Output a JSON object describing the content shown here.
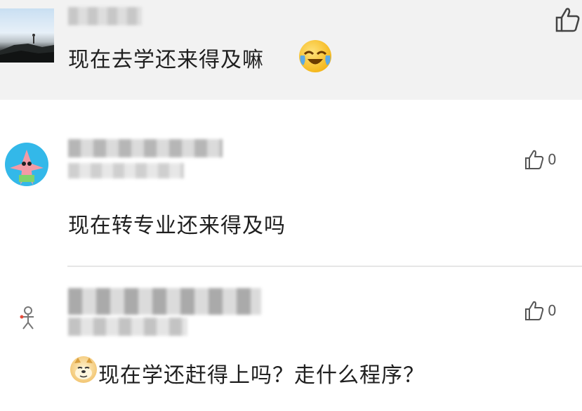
{
  "comments": [
    {
      "text": "现在去学还来得及嘛",
      "emoji": "face-with-tears-of-joy",
      "like_icon": "thumbs-up-icon",
      "like_count": ""
    },
    {
      "text": "现在转专业还来得及吗",
      "emoji": "",
      "like_icon": "thumbs-up-icon",
      "like_count": "0"
    },
    {
      "text": "现在学还赶得上吗？走什么程序？",
      "emoji": "doge-face",
      "like_icon": "thumbs-up-icon",
      "like_count": "0"
    }
  ],
  "colors": {
    "highlight_bg": "#f2f2f2",
    "divider": "#e6e6e6",
    "text": "#1f1f1f",
    "count": "#555555"
  }
}
